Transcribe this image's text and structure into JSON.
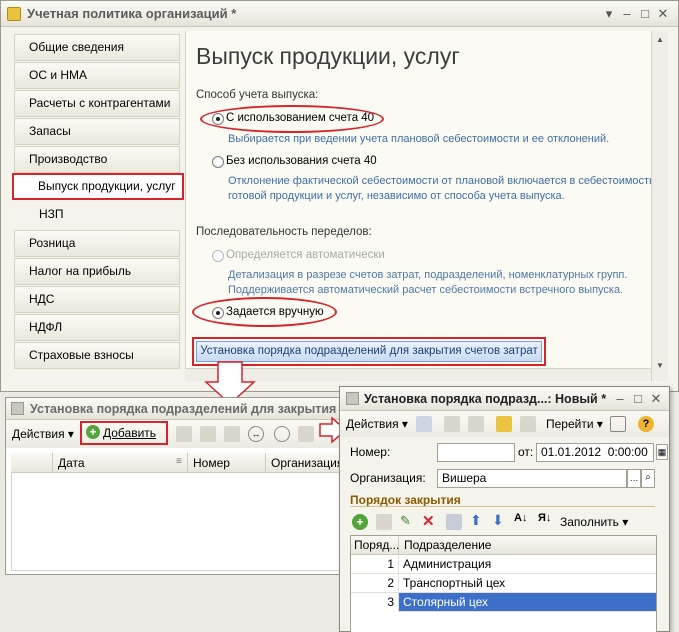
{
  "main_window": {
    "title": "Учетная политика организаций *",
    "sidebar": {
      "items": [
        {
          "label": "Общие сведения"
        },
        {
          "label": "ОС и НМА"
        },
        {
          "label": "Расчеты с контрагентами"
        },
        {
          "label": "Запасы"
        },
        {
          "label": "Производство"
        },
        {
          "label": "Выпуск продукции, услуг"
        },
        {
          "label": "НЗП"
        },
        {
          "label": "Розница"
        },
        {
          "label": "Налог на прибыль"
        },
        {
          "label": "НДС"
        },
        {
          "label": "НДФЛ"
        },
        {
          "label": "Страховые взносы"
        }
      ]
    },
    "content": {
      "heading": "Выпуск продукции, услуг",
      "method_label": "Способ учета выпуска:",
      "option1_label": "С использованием счета 40",
      "option1_hint": "Выбирается при ведении учета плановой себестоимости и ее отклонений.",
      "option2_label": "Без использования счета 40",
      "option2_hint_line1": "Отклонение фактической себестоимости от плановой включается в себестоимость",
      "option2_hint_line2": "готовой продукции и услуг, независимо от способа учета выпуска.",
      "sequence_label": "Последовательность переделов:",
      "option3_label": "Определяется автоматически",
      "option3_hint_line1": "Детализация в разрезе счетов затрат, подразделений, номенклатурных групп.",
      "option3_hint_line2": "Поддерживается автоматический расчет себестоимости встречного выпуска.",
      "option4_label": "Задается вручную",
      "setup_button": "Установка порядка подразделений для закрытия счетов затрат"
    }
  },
  "list_window": {
    "title": "Установка порядка подразделений для закрытия с",
    "actions_label": "Действия",
    "add_label": "Добавить",
    "columns": [
      "Дата",
      "Номер",
      "Организация"
    ]
  },
  "doc_window": {
    "title": "Установка порядка подразд...: Новый *",
    "actions_label": "Действия",
    "goto_label": "Перейти",
    "number_label": "Номер:",
    "number_value": "",
    "from_label": "от:",
    "date_value": "01.01.2012  0:00:00",
    "org_label": "Организация:",
    "org_value": "Вишера",
    "section_title": "Порядок закрытия",
    "fill_label": "Заполнить",
    "table": {
      "col_order": "Поряд...",
      "col_department": "Подразделение",
      "rows": [
        {
          "n": "1",
          "name": "Администрация"
        },
        {
          "n": "2",
          "name": "Транспортный цех"
        },
        {
          "n": "3",
          "name": "Столярный цех"
        }
      ]
    }
  },
  "colors": {
    "highlight_red": "#d6242c",
    "link_blue": "#3f6ea8",
    "selection_blue": "#3c6fc8",
    "section_brown": "#8b5a00"
  }
}
